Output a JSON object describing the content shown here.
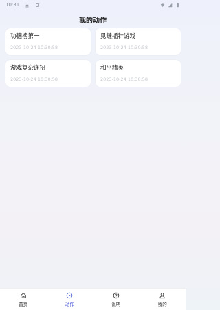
{
  "status_bar": {
    "time": "10:31"
  },
  "page": {
    "title": "我的动作"
  },
  "cards": [
    {
      "title": "功德榜第一",
      "time": "2023-10-24 10:30:58"
    },
    {
      "title": "见缝插针游戏",
      "time": "2023-10-24 10:30:58"
    },
    {
      "title": "游戏复杂连招",
      "time": "2023-10-24 10:30:58"
    },
    {
      "title": "和平精英",
      "time": "2023-10-24 10:30:58"
    }
  ],
  "tabs": [
    {
      "label": "首页",
      "icon": "home-icon",
      "active": false
    },
    {
      "label": "动作",
      "icon": "play-circle-icon",
      "active": true
    },
    {
      "label": "说明",
      "icon": "help-circle-icon",
      "active": false
    },
    {
      "label": "我的",
      "icon": "person-icon",
      "active": false
    }
  ],
  "colors": {
    "accent": "#4f5fd6",
    "card_bg": "#ffffff",
    "time_text": "#c4c6cc"
  }
}
